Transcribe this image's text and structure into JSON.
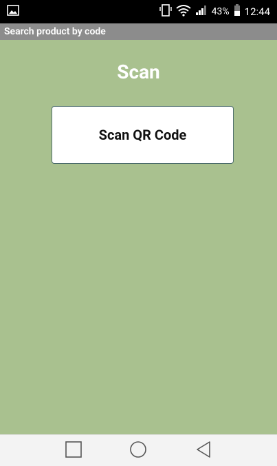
{
  "status_bar": {
    "battery_pct": "43%",
    "time": "12:44",
    "icons": [
      "image-notification-icon",
      "vibrate-icon",
      "wifi-icon",
      "signal-icon",
      "battery-icon"
    ]
  },
  "title_bar": {
    "title": "Search product by code"
  },
  "main": {
    "heading": "Scan",
    "scan_button_label": "Scan QR Code"
  },
  "nav_bar": {
    "buttons": [
      "recent-apps-icon",
      "home-icon",
      "back-icon"
    ]
  },
  "colors": {
    "background": "#a9c18f",
    "title_bar": "#8c8c8c",
    "button_border": "#4a6a6a"
  }
}
